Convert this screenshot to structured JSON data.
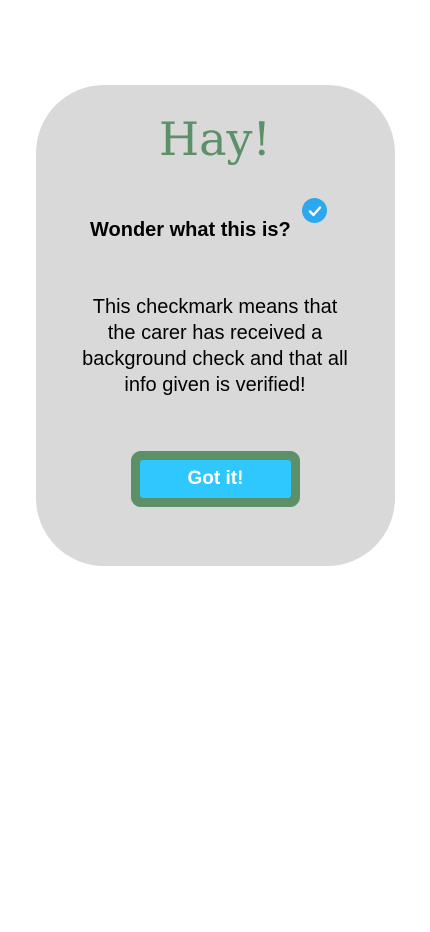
{
  "dialog": {
    "title": "Hay!",
    "question": "Wonder what this is?",
    "badge_icon": "checkmark-badge-icon",
    "description_lines": [
      "This checkmark means that",
      "the carer has received a",
      "background check and that all",
      "info given is verified!"
    ],
    "confirm_label": "Got it!"
  },
  "colors": {
    "card_background": "#d9d9d9",
    "title": "#5c9068",
    "badge": "#2ba8f0",
    "button_fill": "#2ec8ff",
    "button_border": "#5c9068",
    "button_text": "#ffffff"
  }
}
